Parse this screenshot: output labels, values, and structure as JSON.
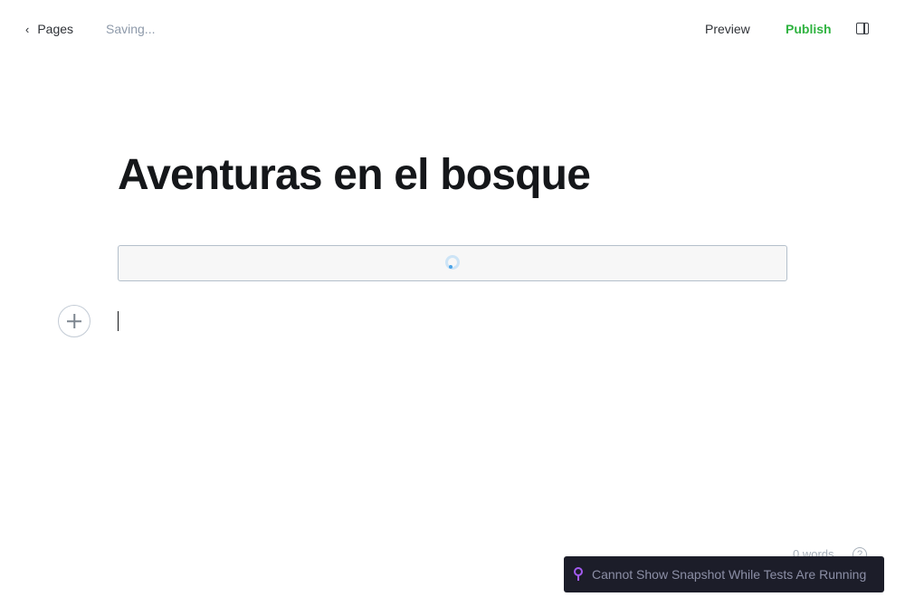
{
  "header": {
    "back_label": "Pages",
    "back_icon": "chevron-left-icon",
    "status": "Saving...",
    "preview_label": "Preview",
    "publish_label": "Publish",
    "sidebar_icon": "sidebar-toggle-icon",
    "publish_color": "#2fb340"
  },
  "editor": {
    "title": "Aventuras en el bosque",
    "help_glyph": "?"
  },
  "footer": {
    "word_count": "0 words"
  },
  "toast": {
    "message": "Cannot Show Snapshot While Tests Are Running"
  }
}
